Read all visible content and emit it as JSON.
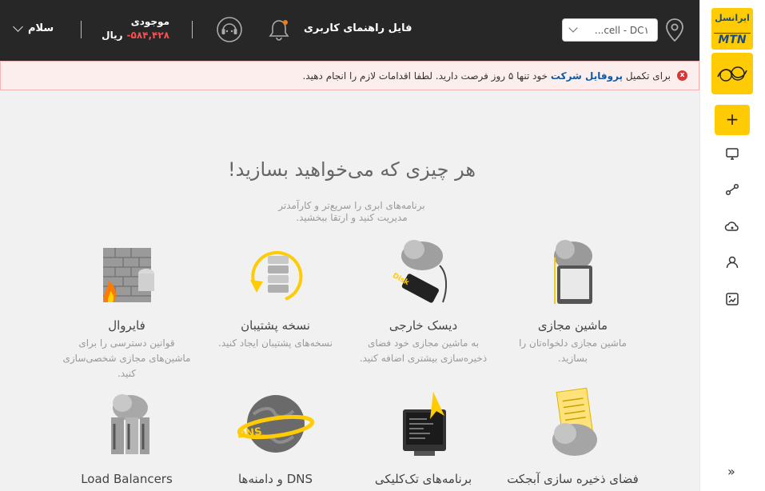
{
  "header": {
    "hello": "سلام",
    "balance_label": "موجودی",
    "balance_amount": "-۵۸۴,۴۲۸",
    "currency": "ریال",
    "guide_link": "فایل راهنمای کاربری",
    "dc_select_value": "...cell - DC۱"
  },
  "alert": {
    "before": "برای تکمیل",
    "link": "پروفایل شرکت",
    "after": "خود تنها ۵ روز فرصت دارید. لطفا اقدامات لازم را انجام دهید.",
    "close_glyph": "x"
  },
  "sidebar": {
    "logo_fa": "ایرانسل",
    "logo_en": "MTN",
    "add_glyph": "+",
    "collapse_glyph": "»"
  },
  "hero": {
    "title": "هر چیزی که می‌خواهید بسازید!",
    "subtitle_line1": "برنامه‌های ابری را سریع‌تر و کارآمدتر",
    "subtitle_line2": "مدیریت کنید و ارتقا ببخشید."
  },
  "cards": [
    {
      "title": "ماشین مجازی",
      "desc": "ماشین مجازی دلخواه‌تان را بسازید."
    },
    {
      "title": "دیسک خارجی",
      "desc": "به ماشین مجازی خود فضای ذخیره‌سازی بیشتری اضافه کنید."
    },
    {
      "title": "نسخه پشتیبان",
      "desc": "نسخه‌های پشتیبان ایجاد کنید."
    },
    {
      "title": "فایروال",
      "desc": "قوانین دسترسی را برای ماشین‌های مجازی شخصی‌سازی کنید."
    },
    {
      "title": "فضای ذخیره سازی آبجکت",
      "desc": ""
    },
    {
      "title": "برنامه‌های تک‌کلیکی",
      "desc": ""
    },
    {
      "title": "DNS و دامنه‌ها",
      "desc": ""
    },
    {
      "title": "Load Balancers",
      "desc": ""
    }
  ],
  "art_labels": {
    "disk": "Disk",
    "dns": "DNS"
  },
  "colors": {
    "brand_yellow": "#ffcb05",
    "topbar": "#272727",
    "alert_bg": "#fdeeee",
    "negative": "#ff4d4d"
  }
}
